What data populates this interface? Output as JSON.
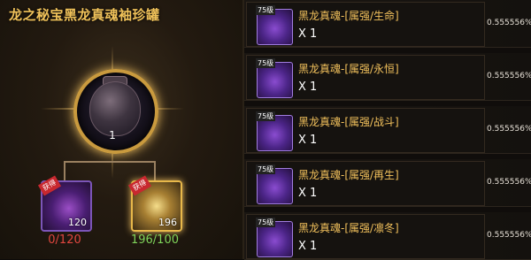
{
  "left_panel": {
    "title": "龙之秘宝黑龙真魂袖珍罐",
    "center_count": "1",
    "slot_a": {
      "tag": "获得",
      "count": "120",
      "ratio": "0/120"
    },
    "slot_b": {
      "tag": "获得",
      "count": "196",
      "ratio": "196/100"
    }
  },
  "reward_list": [
    {
      "level": "75级",
      "name": "黑龙真魂-[属强/生命]",
      "qty": "X 1",
      "chance": "0.555556%"
    },
    {
      "level": "75级",
      "name": "黑龙真魂-[属强/永恒]",
      "qty": "X 1",
      "chance": "0.555556%"
    },
    {
      "level": "75级",
      "name": "黑龙真魂-[属强/战斗]",
      "qty": "X 1",
      "chance": "0.555556%"
    },
    {
      "level": "75级",
      "name": "黑龙真魂-[属强/再生]",
      "qty": "X 1",
      "chance": "0.555556%"
    },
    {
      "level": "75级",
      "name": "黑龙真魂-[属强/凛冬]",
      "qty": "X 1",
      "chance": "0.555556%"
    }
  ],
  "colors": {
    "title": "#f0c25a",
    "red": "#e0463f",
    "green": "#7fd35a",
    "item_name": "#f2c15c"
  }
}
